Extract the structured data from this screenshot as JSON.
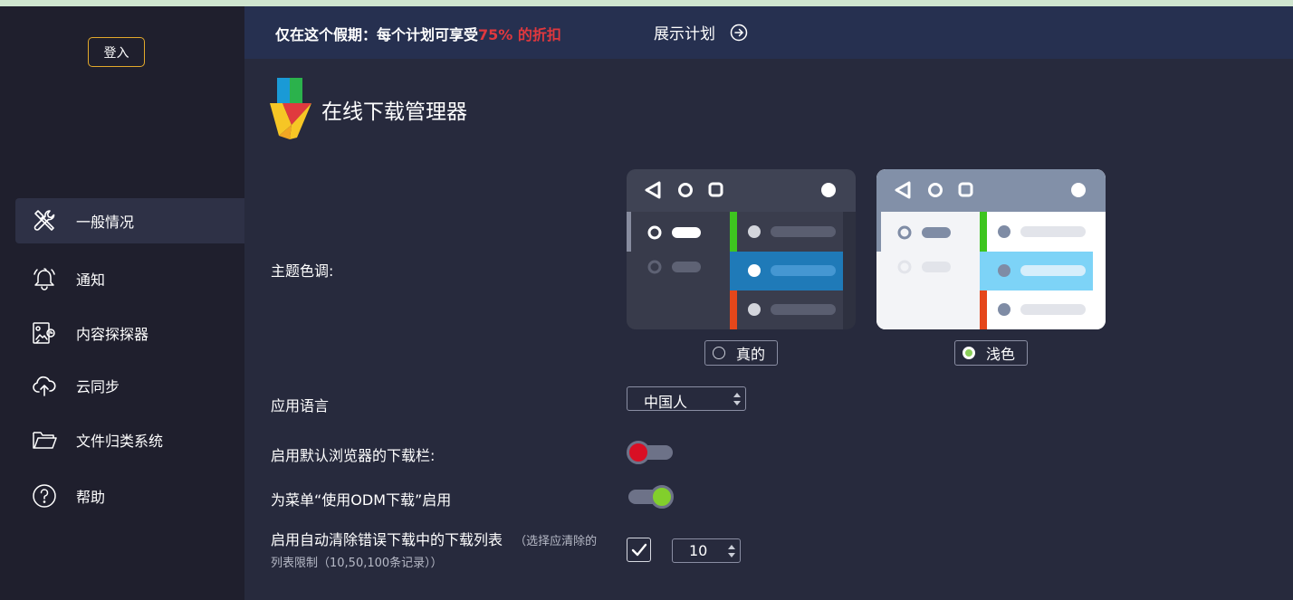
{
  "sidebar": {
    "login_label": "登入",
    "items": [
      {
        "label": "一般情况",
        "icon": "tools-icon",
        "active": true
      },
      {
        "label": "通知",
        "icon": "bell-icon",
        "active": false
      },
      {
        "label": "内容探探器",
        "icon": "content-explorer-icon",
        "active": false
      },
      {
        "label": "云同步",
        "icon": "cloud-upload-icon",
        "active": false
      },
      {
        "label": "文件归类系统",
        "icon": "folder-icon",
        "active": false
      },
      {
        "label": "帮助",
        "icon": "help-icon",
        "active": false
      }
    ]
  },
  "banner": {
    "promo_text": "仅在这个假期：每个计划可享受",
    "promo_highlight": "75% 的折扣",
    "show_plans_label": "展示计划",
    "highlight_color": "#e0383e"
  },
  "app": {
    "title": "在线下载管理器"
  },
  "settings": {
    "theme_label": "主题色调:",
    "theme_options": [
      {
        "label": "真的",
        "selected": false
      },
      {
        "label": "浅色",
        "selected": true
      }
    ],
    "language_label": "应用语言",
    "language_value": "中国人",
    "default_browser_bar_label": "启用默认浏览器的下载栏:",
    "default_browser_bar_enabled": false,
    "menu_odm_label": "为菜单“使用ODM下载”启用",
    "menu_odm_enabled": true,
    "auto_clear_label": "启用自动清除错误下载中的下载列表",
    "auto_clear_hint_1": "（选择应清除的",
    "auto_clear_hint_2": "列表限制（10,50,100条记录））",
    "auto_clear_enabled": true,
    "auto_clear_limit": "10"
  },
  "colors": {
    "accent_login_border": "#e3a92b",
    "toggle_off_knob": "#d90f24",
    "toggle_on_knob": "#82cf2c",
    "radio_selected": "#8bcf5a"
  }
}
